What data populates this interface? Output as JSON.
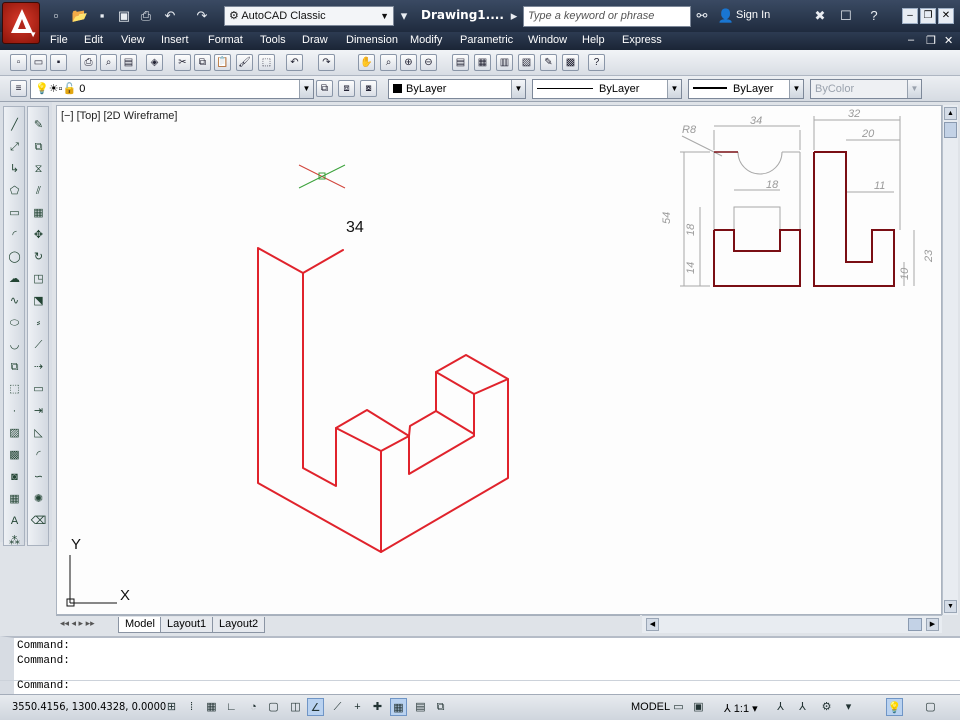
{
  "window": {
    "doc_title": "Drawing1....",
    "workspace": "AutoCAD Classic",
    "search_placeholder": "Type a keyword or phrase",
    "sign_in": "Sign In"
  },
  "menu": [
    "File",
    "Edit",
    "View",
    "Insert",
    "Format",
    "Tools",
    "Draw",
    "Dimension",
    "Modify",
    "Parametric",
    "Window",
    "Help",
    "Express"
  ],
  "layers": {
    "current_layer": "0",
    "color": "ByLayer",
    "linetype": "ByLayer",
    "lineweight": "ByLayer",
    "plot_style": "ByColor"
  },
  "viewport": {
    "label": "[−] [Top] [2D Wireframe]",
    "dimension_text": "34"
  },
  "ucs": {
    "x_label": "X",
    "y_label": "Y"
  },
  "reference": {
    "dims": [
      "R8",
      "34",
      "32",
      "20",
      "18",
      "11",
      "54",
      "18",
      "14",
      "23",
      "10"
    ]
  },
  "tabs": [
    "Model",
    "Layout1",
    "Layout2"
  ],
  "command": {
    "lines": [
      "Command:",
      "Command:"
    ],
    "prompt": "Command:"
  },
  "status": {
    "coords": "3550.4156, 1300.4328, 0.0000",
    "space": "MODEL",
    "scale": "1:1"
  },
  "colors": {
    "drawing": "#e0232c",
    "reference_outline": "#7a0e14",
    "reference_dims": "#9a9a9a",
    "accent": "#1f2b3e"
  }
}
